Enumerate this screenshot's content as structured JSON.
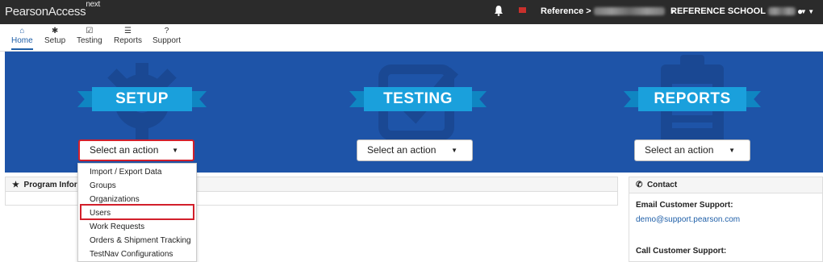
{
  "topbar": {
    "logo_main": "PearsonAccess",
    "logo_sup": "next",
    "reference_label": "Reference >",
    "school_label": "REFERENCE SCHOOL"
  },
  "nav": [
    {
      "label": "Home",
      "icon": "home-icon",
      "glyph": "⌂"
    },
    {
      "label": "Setup",
      "icon": "gear-icon",
      "glyph": "✱"
    },
    {
      "label": "Testing",
      "icon": "checkbox-icon",
      "glyph": "☑"
    },
    {
      "label": "Reports",
      "icon": "reports-icon",
      "glyph": "☰"
    },
    {
      "label": "Support",
      "icon": "question-icon",
      "glyph": "?"
    }
  ],
  "hero": {
    "setup_title": "SETUP",
    "testing_title": "TESTING",
    "reports_title": "REPORTS",
    "select_label": "Select an action"
  },
  "program_panel": {
    "title": "Program Inform"
  },
  "setup_menu": {
    "items": [
      "Import / Export Data",
      "Groups",
      "Organizations",
      "Users",
      "Work Requests",
      "Orders & Shipment Tracking",
      "TestNav Configurations"
    ],
    "highlighted": "Users"
  },
  "contact": {
    "title": "Contact",
    "email_heading": "Email Customer Support:",
    "email": "demo@support.pearson.com",
    "call_heading": "Call Customer Support:"
  },
  "colors": {
    "hero_blue": "#1e54a8",
    "banner_blue": "#1aa0dc",
    "highlight_red": "#d21f2b",
    "topbar": "#2b2b2b"
  }
}
